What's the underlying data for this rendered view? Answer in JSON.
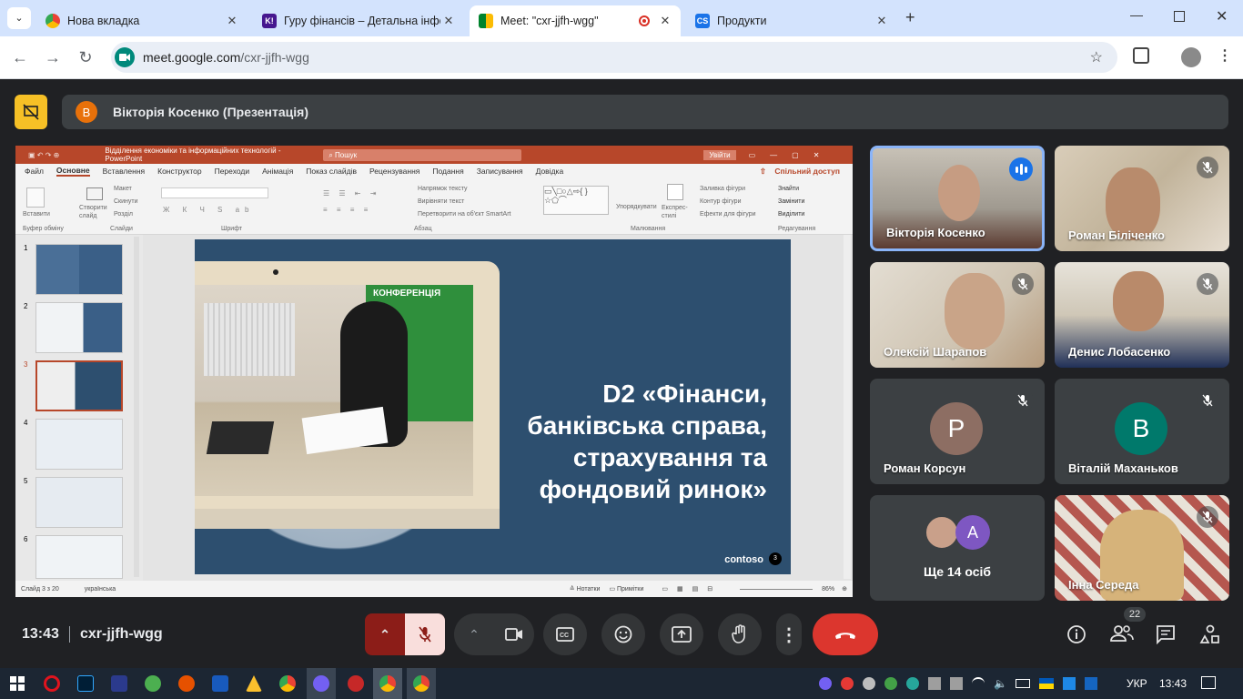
{
  "browser": {
    "tabs": [
      {
        "title": "Нова вкладка",
        "favicon": "chrome-icon"
      },
      {
        "title": "Гуру фінансів – Детальна інфо",
        "favicon": "kahoot-icon",
        "fav_text": "K!"
      },
      {
        "title": "Meet: \"cxr-jjfh-wgg\"",
        "favicon": "google-meet-icon",
        "active": true
      },
      {
        "title": "Продукти",
        "favicon": "cs-icon",
        "fav_text": "CS"
      }
    ],
    "url_domain": "meet.google.com",
    "url_path": "/cxr-jjfh-wgg"
  },
  "meet": {
    "presenter_initial": "В",
    "presenter_label": "Вікторія Косенко (Презентація)",
    "time": "13:43",
    "meeting_code": "cxr-jjfh-wgg",
    "people_count": "22",
    "participants": [
      {
        "name": "Вікторія Косенко",
        "type": "video",
        "speaking": true
      },
      {
        "name": "Роман Біліченко",
        "type": "video",
        "muted": true
      },
      {
        "name": "Олексій Шарапов",
        "type": "video",
        "muted": true
      },
      {
        "name": "Денис Лобасенко",
        "type": "video",
        "muted": true
      },
      {
        "name": "Роман Корсун",
        "type": "avatar",
        "initial": "P",
        "muted": true,
        "color": "#8d6e63"
      },
      {
        "name": "Віталій Маханьков",
        "type": "avatar",
        "initial": "B",
        "muted": true,
        "color": "#00796b"
      },
      {
        "name": "Ще 14 осіб",
        "type": "more",
        "initial": "A",
        "color": "#7e57c2"
      },
      {
        "name": "Інна Середа",
        "type": "video",
        "muted": true
      }
    ]
  },
  "ppt": {
    "title": "Відділення економіки та інформаційних технологій - PowerPoint",
    "search": "Пошук",
    "signin": "Увійти",
    "menu": [
      "Файл",
      "Основне",
      "Вставлення",
      "Конструктор",
      "Переходи",
      "Анімація",
      "Показ слайдів",
      "Рецензування",
      "Подання",
      "Записування",
      "Довідка"
    ],
    "share": "Спільний доступ",
    "ribbon_groups": [
      "Буфер обміну",
      "Слайди",
      "Шрифт",
      "Абзац",
      "Малювання",
      "Редагування"
    ],
    "ribbon_items": [
      "Вставити",
      "Створити слайд",
      "Макет",
      "Скинути",
      "Розділ",
      "Напрямок тексту",
      "Вирівняти текст",
      "Перетворити на об'єкт SmartArt",
      "Упорядкувати",
      "Експрес-стилі",
      "Заливка фігури",
      "Контур фігури",
      "Ефекти для фігури",
      "Знайти",
      "Замінити",
      "Виділити"
    ],
    "slide_numbers": [
      "1",
      "2",
      "3",
      "4",
      "5",
      "6"
    ],
    "slide_title": [
      "D2 «Фінанси,",
      "банківська справа,",
      "страхування та",
      "фондовий ринок»"
    ],
    "slide_badge": "КОНФЕРЕНЦІЯ",
    "brand": "contoso",
    "slide_page": "3",
    "status_left": "Слайд 3 з 20",
    "status_lang": "українська",
    "status_notes": "Нотатки",
    "status_comments": "Примітки",
    "zoom": "86%"
  },
  "taskbar": {
    "lang": "УКР",
    "time": "13:43"
  }
}
